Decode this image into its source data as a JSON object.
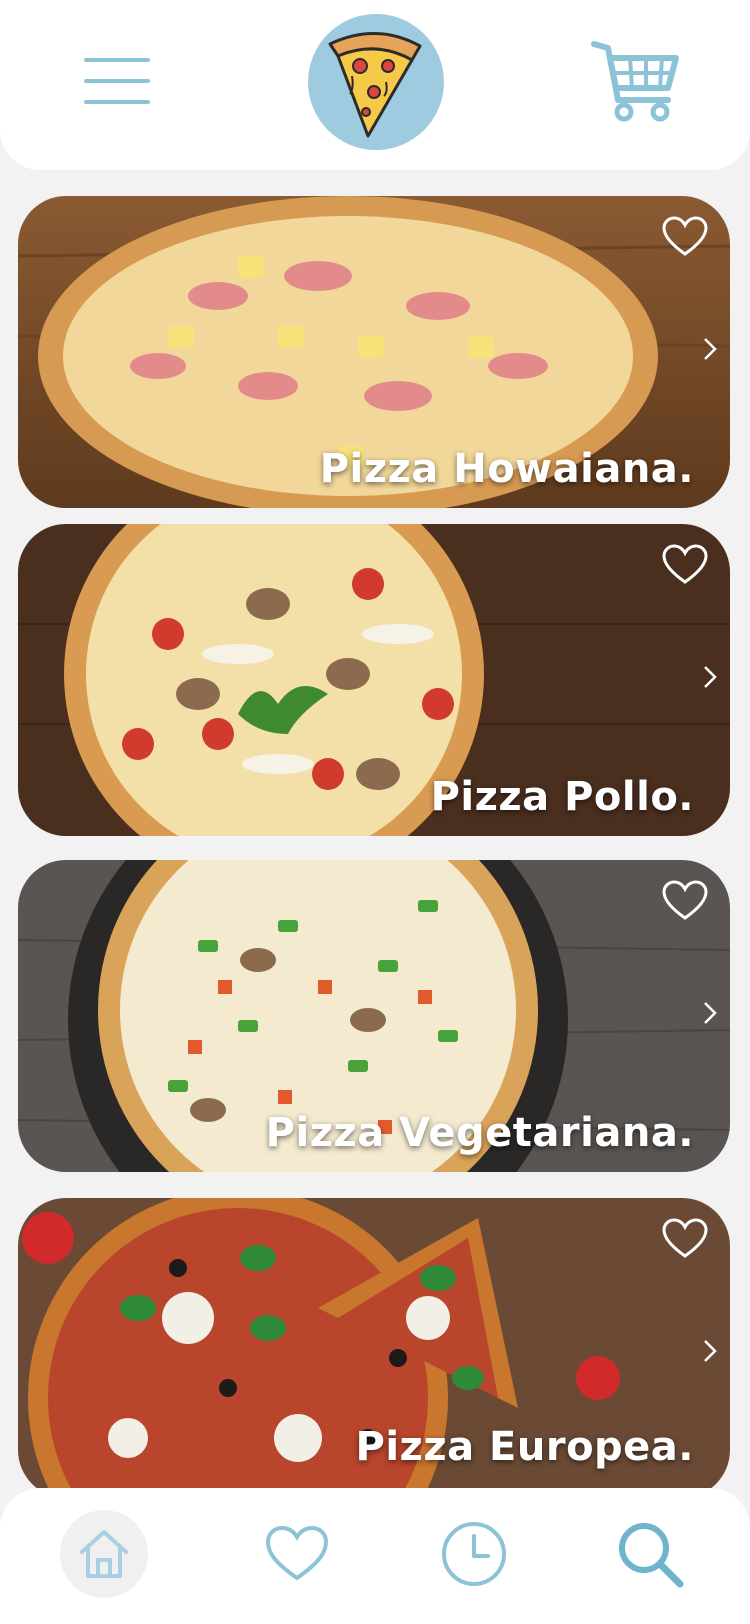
{
  "header": {
    "menu_icon": "hamburger-menu-icon",
    "logo_icon": "pizza-slice-logo",
    "cart_icon": "shopping-cart-icon",
    "accent_color": "#8cc3d6"
  },
  "pizzas": [
    {
      "title": "Pizza Howaiana.",
      "favorite_icon": "heart-outline-icon",
      "arrow_icon": "chevron-right-icon"
    },
    {
      "title": "Pizza Pollo.",
      "favorite_icon": "heart-outline-icon",
      "arrow_icon": "chevron-right-icon"
    },
    {
      "title": "Pizza Vegetariana.",
      "favorite_icon": "heart-outline-icon",
      "arrow_icon": "chevron-right-icon"
    },
    {
      "title": "Pizza Europea.",
      "favorite_icon": "heart-outline-icon",
      "arrow_icon": "chevron-right-icon"
    }
  ],
  "bottom_nav": {
    "items": [
      {
        "icon": "home-icon",
        "active": true
      },
      {
        "icon": "heart-icon",
        "active": false
      },
      {
        "icon": "clock-icon",
        "active": false
      },
      {
        "icon": "search-icon",
        "active": false
      }
    ]
  }
}
